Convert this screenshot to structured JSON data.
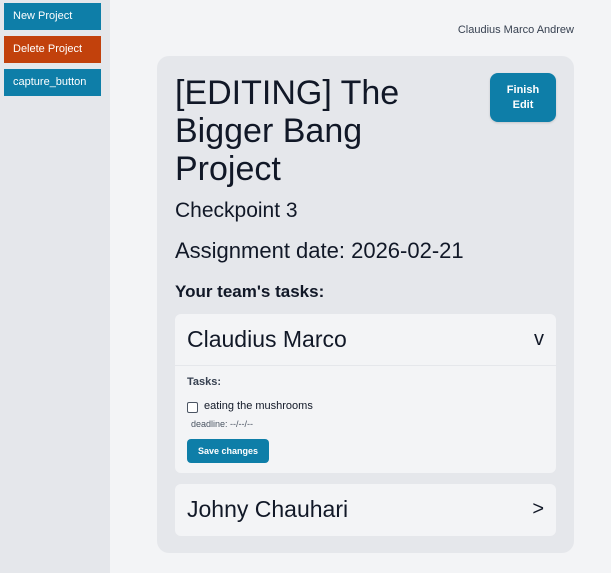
{
  "sidebar": {
    "new_project_label": "New Project",
    "delete_project_label": "Delete Project",
    "capture_label": "capture_button"
  },
  "header": {
    "username": "Claudius Marco Andrew"
  },
  "project": {
    "title": "[EDITING] The Bigger Bang Project",
    "finish_edit_label": "Finish Edit",
    "checkpoint": "Checkpoint 3",
    "assignment": "Assignment date: 2026-02-21",
    "tasks_heading": "Your team's tasks:"
  },
  "members": [
    {
      "name": "Claudius Marco",
      "toggle": "v",
      "tasks_label": "Tasks:",
      "tasks": [
        {
          "text": "eating the mushrooms",
          "deadline": "deadline: --/--/--",
          "checked": false
        }
      ],
      "save_label": "Save changes"
    },
    {
      "name": "Johny Chauhari",
      "toggle": ">"
    }
  ],
  "colors": {
    "primary": "#0e7ea8",
    "danger": "#c2410c"
  }
}
